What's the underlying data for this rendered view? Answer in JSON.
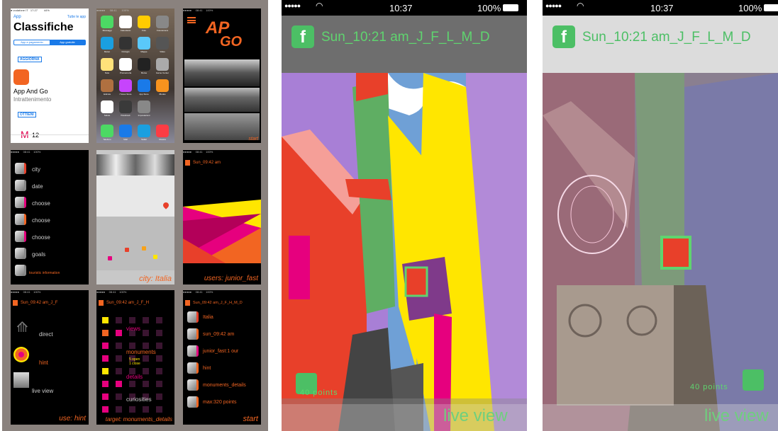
{
  "grid": {
    "appstore": {
      "back": "App",
      "all_apps": "Tutte le app",
      "title": "Classifiche",
      "seg_paid": "App a pagamento",
      "seg_free": "App gratuite",
      "update": "AGGIORNA",
      "app_name": "App And Go",
      "app_category": "Intrattenimento",
      "get": "OTTIENI",
      "mail_count": "12"
    },
    "home": {
      "icons": [
        "Messaggi",
        "Calendario",
        "Foto",
        "Fotocamera",
        "Meteo",
        "Orologio",
        "Mappe",
        "Video",
        "Note",
        "Promemoria",
        "Borsa",
        "Game Center",
        "Edicola",
        "iTunes Store",
        "App Store",
        "iBooks",
        "Salute",
        "Passbook",
        "Impostazioni",
        "",
        "Telefono",
        "Mail",
        "Safari",
        "Musica"
      ]
    },
    "splash": {
      "logo_top": "AP",
      "logo_sup": "P",
      "logo_bottom": "GO",
      "start": "start"
    },
    "menu": {
      "items": [
        "city",
        "date",
        "choose",
        "choose",
        "choose",
        "goals",
        "touristic information"
      ]
    },
    "city": {
      "caption": "city: Italia"
    },
    "users": {
      "status": "Sun_09:42 am",
      "caption": "users: junior_fast"
    },
    "use": {
      "status": "Sun_09:42 am_J_F",
      "direct": "direct",
      "hint": "hint",
      "live": "live view",
      "caption": "use: hint"
    },
    "target": {
      "status": "Sun_09:42 am_J_F_H",
      "views": "views",
      "monuments": "monuments",
      "monuments_sub": "5 open\n1 close",
      "details": "details",
      "curiosities": "curiosities",
      "caption": "target: monuments_details"
    },
    "summary": {
      "status": "Sun_09:42 am_J_F_H_M_D",
      "items": [
        "Italia",
        "sun_09:42 am",
        "junior_fast:1 our",
        "hint",
        "monuments_details",
        "max:320 points"
      ],
      "caption": "start"
    }
  },
  "phone1": {
    "status": {
      "signal": "●●●●● ",
      "time": "10:37",
      "battery": "100%"
    },
    "header": "Sun_10:21 am_J_F_L_M_D",
    "points": "40 points",
    "live": "live view"
  },
  "phone2": {
    "status": {
      "signal": "●●●●● ",
      "time": "10:37",
      "battery": "100%"
    },
    "header": "Sun_10:21 am_J_F_L_M_D",
    "points": "40 points",
    "live": "live view"
  },
  "colors": {
    "accent_green": "#5cb85c",
    "orange": "#f26522",
    "pink": "#e6007e",
    "yellow": "#ffe600"
  }
}
